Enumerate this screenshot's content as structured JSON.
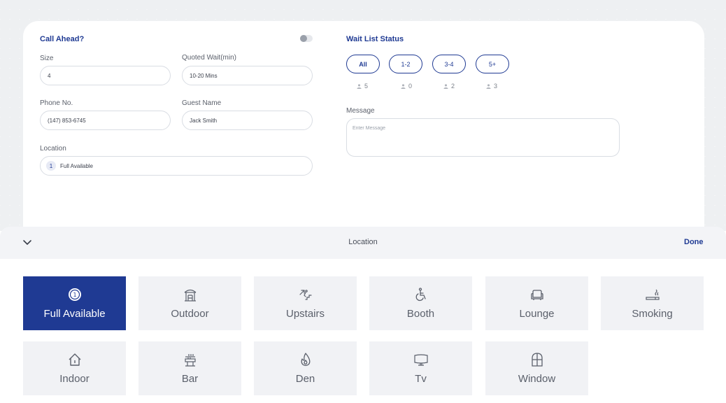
{
  "form": {
    "call_ahead_title": "Call Ahead?",
    "size_label": "Size",
    "size_value": "4",
    "quoted_wait_label": "Quoted Wait(min)",
    "quoted_wait_value": "10-20 Mins",
    "phone_label": "Phone No.",
    "phone_value": "(147) 853-6745",
    "guest_name_label": "Guest Name",
    "guest_name_value": "Jack Smith",
    "location_label": "Location",
    "location_badge": "1",
    "location_value": "Full Available"
  },
  "wait_list": {
    "title": "Wait List Status",
    "pills": [
      {
        "label": "All",
        "count": "5"
      },
      {
        "label": "1-2",
        "count": "0"
      },
      {
        "label": "3-4",
        "count": "2"
      },
      {
        "label": "5+",
        "count": "3"
      }
    ],
    "message_label": "Message",
    "message_placeholder": "Enter Message"
  },
  "location_bar": {
    "title": "Location",
    "done_label": "Done"
  },
  "locations": [
    {
      "label": "Full Available",
      "icon": "one-circle-icon",
      "active": true
    },
    {
      "label": "Outdoor",
      "icon": "gazebo-icon"
    },
    {
      "label": "Upstairs",
      "icon": "stairs-icon"
    },
    {
      "label": "Booth",
      "icon": "wheelchair-icon"
    },
    {
      "label": "Lounge",
      "icon": "sofa-icon"
    },
    {
      "label": "Smoking",
      "icon": "cigarette-icon"
    },
    {
      "label": "Indoor",
      "icon": "house-icon"
    },
    {
      "label": "Bar",
      "icon": "bar-counter-icon"
    },
    {
      "label": "Den",
      "icon": "fire-icon"
    },
    {
      "label": "Tv",
      "icon": "tv-icon"
    },
    {
      "label": "Window",
      "icon": "window-icon"
    }
  ],
  "colors": {
    "accent": "#1f3a93",
    "tile_bg": "#f1f2f5"
  }
}
